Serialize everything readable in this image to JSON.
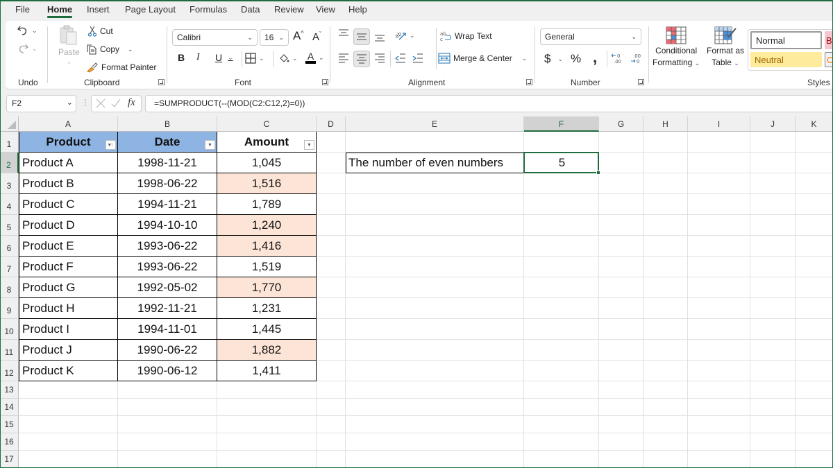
{
  "menu": {
    "tabs": [
      "File",
      "Home",
      "Insert",
      "Page Layout",
      "Formulas",
      "Data",
      "Review",
      "View",
      "Help"
    ],
    "active": "Home"
  },
  "ribbon": {
    "undo": {
      "group_label": "Undo"
    },
    "clipboard": {
      "group_label": "Clipboard",
      "paste": "Paste",
      "cut": "Cut",
      "copy": "Copy",
      "format_painter": "Format Painter"
    },
    "font": {
      "group_label": "Font",
      "font_name": "Calibri",
      "font_size": "16",
      "bold": "B",
      "italic": "I",
      "underline": "U",
      "font_color_letter": "A",
      "font_color": "#000000"
    },
    "alignment": {
      "group_label": "Alignment",
      "wrap_text": "Wrap Text",
      "merge_center": "Merge & Center"
    },
    "number": {
      "group_label": "Number",
      "format": "General",
      "currency": "$",
      "percent": "%",
      "comma": ","
    },
    "styles": {
      "group_label": "Styles",
      "conditional_formatting_1": "Conditional",
      "conditional_formatting_2": "Formatting",
      "format_as_table_1": "Format as",
      "format_as_table_2": "Table",
      "normal": "Normal",
      "neutral": "Neutral",
      "bad_partial": "B",
      "calc_partial": "C"
    }
  },
  "formula_bar": {
    "name_box": "F2",
    "fx": "fx",
    "formula": "=SUMPRODUCT(--(MOD(C2:C12,2)=0))"
  },
  "sheet": {
    "columns": [
      "A",
      "B",
      "C",
      "D",
      "E",
      "F",
      "G",
      "H",
      "I",
      "J",
      "K"
    ],
    "rows": [
      "1",
      "2",
      "3",
      "4",
      "5",
      "6",
      "7",
      "8",
      "9",
      "10",
      "11",
      "12",
      "13",
      "14",
      "15",
      "16",
      "17"
    ],
    "selected_cell": "F2",
    "table": {
      "headers": [
        "Product",
        "Date",
        "Amount"
      ],
      "header_fill": "#8eb4e3",
      "highlight_fill": "#fce4d6",
      "rows": [
        {
          "product": "Product A",
          "date": "1998-11-21",
          "amount": "1,045",
          "highlight": false
        },
        {
          "product": "Product B",
          "date": "1998-06-22",
          "amount": "1,516",
          "highlight": true
        },
        {
          "product": "Product C",
          "date": "1994-11-21",
          "amount": "1,789",
          "highlight": false
        },
        {
          "product": "Product D",
          "date": "1994-10-10",
          "amount": "1,240",
          "highlight": true
        },
        {
          "product": "Product E",
          "date": "1993-06-22",
          "amount": "1,416",
          "highlight": true
        },
        {
          "product": "Product F",
          "date": "1993-06-22",
          "amount": "1,519",
          "highlight": false
        },
        {
          "product": "Product G",
          "date": "1992-05-02",
          "amount": "1,770",
          "highlight": true
        },
        {
          "product": "Product H",
          "date": "1992-11-21",
          "amount": "1,231",
          "highlight": false
        },
        {
          "product": "Product I",
          "date": "1994-11-01",
          "amount": "1,445",
          "highlight": false
        },
        {
          "product": "Product J",
          "date": "1990-06-22",
          "amount": "1,882",
          "highlight": true
        },
        {
          "product": "Product K",
          "date": "1990-06-12",
          "amount": "1,411",
          "highlight": false
        }
      ]
    },
    "result": {
      "label": "The number of even numbers",
      "value": "5"
    }
  }
}
